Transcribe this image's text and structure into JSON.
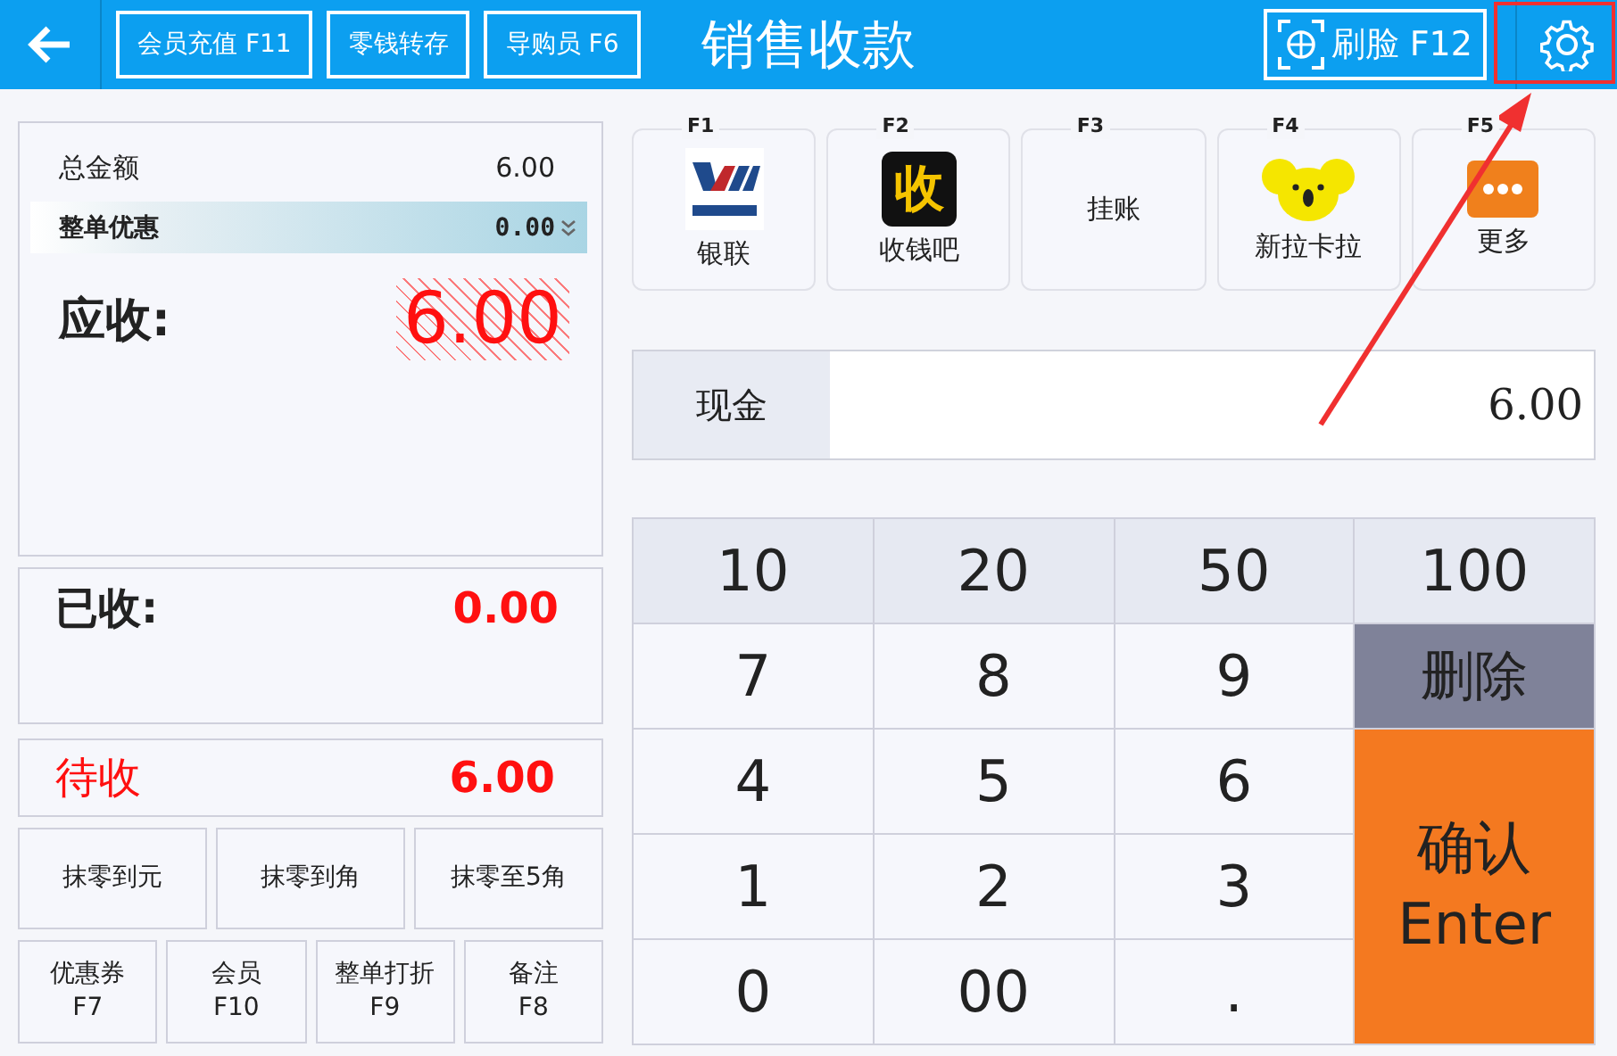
{
  "header": {
    "title": "销售收款",
    "buttons": [
      "会员充值 F11",
      "零钱转存",
      "导购员 F6"
    ],
    "face_button": "刷脸 F12"
  },
  "summary": {
    "total_label": "总金额",
    "total_value": "6.00",
    "discount_label": "整单优惠",
    "discount_value": "0.00",
    "due_label": "应收:",
    "due_value": "6.00"
  },
  "received": {
    "label": "已收:",
    "value": "0.00"
  },
  "pending": {
    "label": "待收",
    "value": "6.00"
  },
  "rounding_buttons": [
    "抹零到元",
    "抹零到角",
    "抹零至5角"
  ],
  "function_buttons": [
    {
      "label": "优惠券",
      "key": "F7"
    },
    {
      "label": "会员",
      "key": "F10"
    },
    {
      "label": "整单打折",
      "key": "F9"
    },
    {
      "label": "备注",
      "key": "F8"
    }
  ],
  "payment_methods": [
    {
      "key": "F1",
      "label": "银联",
      "kind": "unionpay"
    },
    {
      "key": "F2",
      "label": "收钱吧",
      "kind": "shouqianba",
      "logo_text": "收"
    },
    {
      "key": "F3",
      "label": "挂账",
      "kind": "text"
    },
    {
      "key": "F4",
      "label": "新拉卡拉",
      "kind": "koala"
    },
    {
      "key": "F5",
      "label": "更多",
      "kind": "more"
    }
  ],
  "cash": {
    "label": "现金",
    "value": "6.00"
  },
  "quick_keys": [
    "10",
    "20",
    "50",
    "100"
  ],
  "digit_keys": [
    "7",
    "8",
    "9",
    "4",
    "5",
    "6",
    "1",
    "2",
    "3",
    "0",
    "00",
    "."
  ],
  "side_keys": [
    {
      "label": "删除",
      "kind": "delete"
    },
    {
      "label": "确认\nEnter",
      "kind": "confirm"
    }
  ]
}
